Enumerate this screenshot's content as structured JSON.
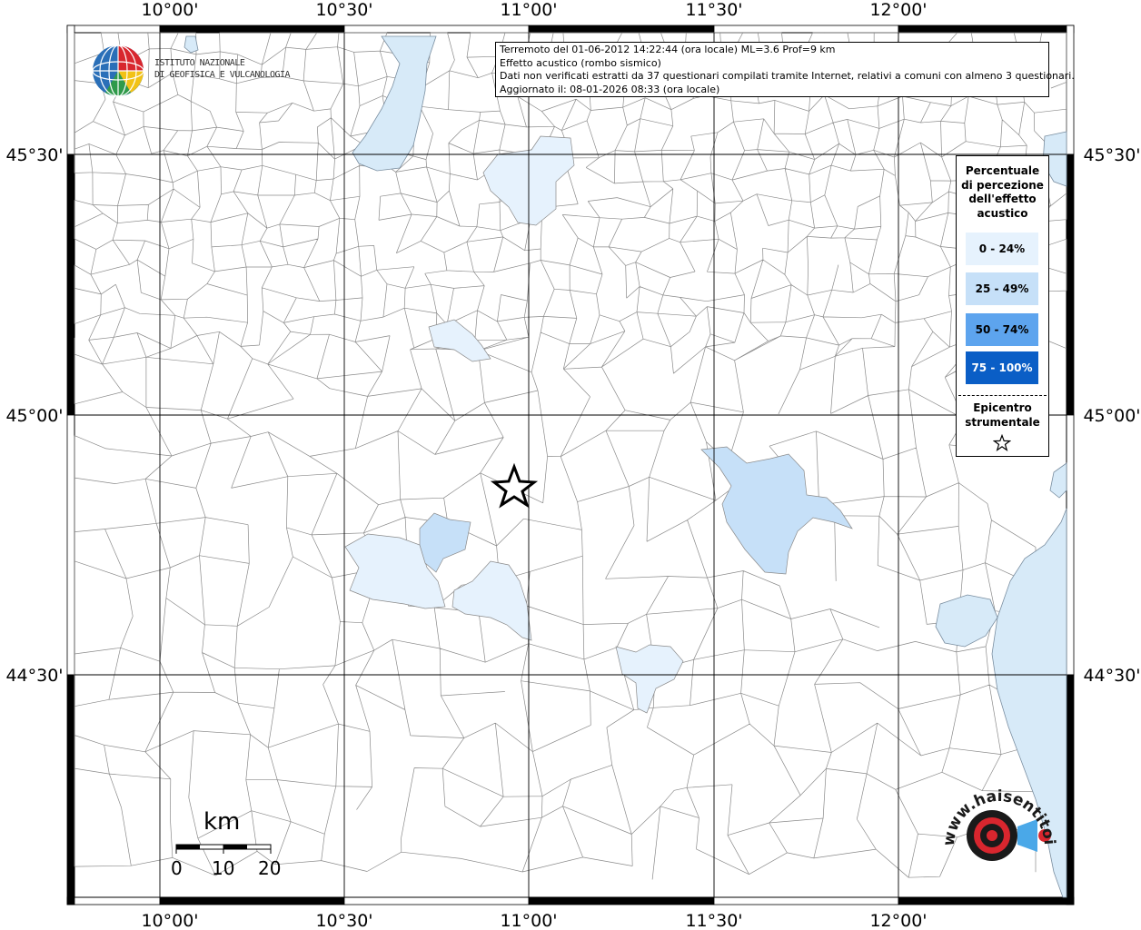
{
  "info": {
    "line1": "Terremoto del 01-06-2012 14:22:44 (ora locale) ML=3.6 Prof=9 km",
    "line2": "Effetto acustico (rombo sismico)",
    "line3": "Dati non verificati estratti da 37 questionari compilati tramite Internet, relativi a comuni con almeno 3 questionari.",
    "line4": "Aggiornato il: 08-01-2026 08:33 (ora locale)"
  },
  "axes": {
    "lon_ticks": [
      "10°00'",
      "10°30'",
      "11°00'",
      "11°30'",
      "12°00'"
    ],
    "lat_ticks": [
      "45°30'",
      "45°00'",
      "44°30'"
    ]
  },
  "legend": {
    "title_lines": [
      "Percentuale",
      "di percezione",
      "dell'effetto",
      "acustico"
    ],
    "classes": [
      {
        "label": "0 - 24%",
        "color": "#e6f2fd"
      },
      {
        "label": "25 - 49%",
        "color": "#c6e0f8"
      },
      {
        "label": "50 - 74%",
        "color": "#5da4ee"
      },
      {
        "label": "75 - 100%",
        "color": "#0a5ec6"
      }
    ],
    "epicenter_lines": [
      "Epicentro",
      "strumentale"
    ]
  },
  "logo": {
    "ingv_line1": "ISTITUTO NAZIONALE",
    "ingv_line2": "DI GEOFISICA E VULCANOLOGIA",
    "hsi_text": "www.haisentitoilterremoto.it"
  },
  "scalebar": {
    "unit": "km",
    "ticks": [
      "0",
      "10",
      "20"
    ]
  },
  "colors": {
    "water": "#d7eaf8",
    "class_0_24": "#e6f2fd",
    "class_25_49": "#c6e0f8"
  }
}
